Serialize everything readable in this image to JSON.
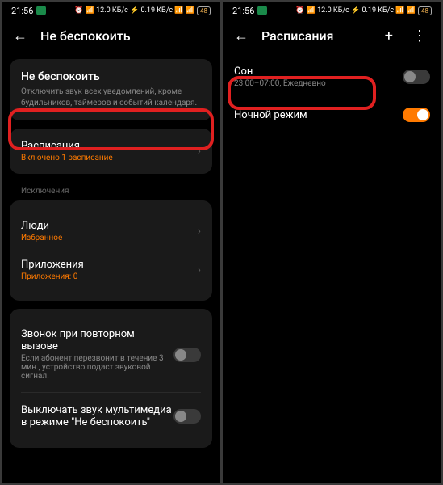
{
  "status": {
    "time": "21:56",
    "icons_right": "⏰ 📶 12.0 КБ/с ⚡ 0.19 КБ/с 📶 📶",
    "battery": "48"
  },
  "left": {
    "header_title": "Не беспокоить",
    "dnd": {
      "title": "Не беспокоить",
      "subtitle": "Отключить звук всех уведомлений, кроме будильников, таймеров и событий календаря."
    },
    "schedules": {
      "title": "Расписания",
      "subtitle": "Включено 1 расписание"
    },
    "exceptions_label": "Исключения",
    "people": {
      "title": "Люди",
      "subtitle": "Избранное"
    },
    "apps": {
      "title": "Приложения",
      "subtitle": "Приложения: 0"
    },
    "repeat_call": {
      "title": "Звонок при повторном вызове",
      "subtitle": "Если абонент перезвонит в течение 3 мин., устройство подаст звуковой сигнал."
    },
    "mute_media": {
      "title": "Выключать звук мультимедиа в режиме \"Не беспокоить\""
    }
  },
  "right": {
    "header_title": "Расписания",
    "sleep": {
      "title": "Сон",
      "subtitle": "23:00–07:00, Ежедневно"
    },
    "night": {
      "title": "Ночной режим"
    }
  }
}
